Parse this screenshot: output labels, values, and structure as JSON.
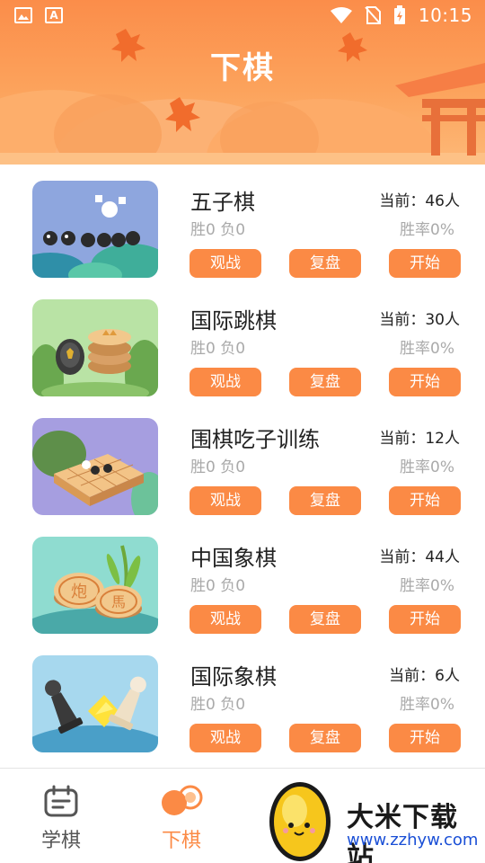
{
  "status": {
    "time": "10:15",
    "keyboard_indicator": "A"
  },
  "header": {
    "title": "下棋"
  },
  "games": [
    {
      "name": "五子棋",
      "online": "当前：46人",
      "record": "胜0 负0",
      "win_rate": "胜率0%",
      "watch": "观战",
      "review": "复盘",
      "start": "开始"
    },
    {
      "name": "国际跳棋",
      "online": "当前：30人",
      "record": "胜0 负0",
      "win_rate": "胜率0%",
      "watch": "观战",
      "review": "复盘",
      "start": "开始"
    },
    {
      "name": "围棋吃子训练",
      "online": "当前：12人",
      "record": "胜0 负0",
      "win_rate": "胜率0%",
      "watch": "观战",
      "review": "复盘",
      "start": "开始"
    },
    {
      "name": "中国象棋",
      "online": "当前：44人",
      "record": "胜0 负0",
      "win_rate": "胜率0%",
      "watch": "观战",
      "review": "复盘",
      "start": "开始"
    },
    {
      "name": "国际象棋",
      "online": "当前：6人",
      "record": "胜0 负0",
      "win_rate": "胜率0%",
      "watch": "观战",
      "review": "复盘",
      "start": "开始"
    }
  ],
  "thumb_text": {
    "xiangqi_1": "炮",
    "xiangqi_2": "馬"
  },
  "bottom_nav": {
    "learn": "学棋",
    "play": "下棋"
  },
  "watermark": {
    "title": "大米下载站",
    "url": "www.zzhyw.com"
  },
  "colors": {
    "accent": "#fb8a45",
    "header_top": "#fb8d4a",
    "text_muted": "#aaaaaa"
  }
}
